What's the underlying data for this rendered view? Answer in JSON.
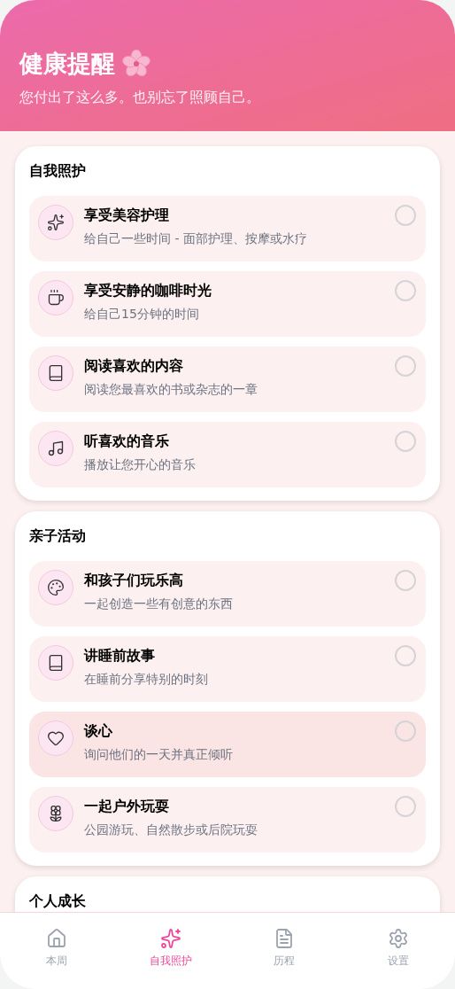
{
  "header": {
    "title": "健康提醒",
    "subtitle": "您付出了这么多。也别忘了照顾自己。"
  },
  "sections": [
    {
      "title": "自我照护",
      "items": [
        {
          "title": "享受美容护理",
          "subtitle": "给自己一些时间 - 面部护理、按摩或水疗",
          "checked": false,
          "highlighted": false
        },
        {
          "title": "享受安静的咖啡时光",
          "subtitle": "给自己15分钟的时间",
          "checked": false,
          "highlighted": false
        },
        {
          "title": "阅读喜欢的内容",
          "subtitle": "阅读您最喜欢的书或杂志的一章",
          "checked": false,
          "highlighted": false
        },
        {
          "title": "听喜欢的音乐",
          "subtitle": "播放让您开心的音乐",
          "checked": false,
          "highlighted": false
        }
      ]
    },
    {
      "title": "亲子活动",
      "items": [
        {
          "title": "和孩子们玩乐高",
          "subtitle": "一起创造一些有创意的东西",
          "checked": false,
          "highlighted": false
        },
        {
          "title": "讲睡前故事",
          "subtitle": "在睡前分享特别的时刻",
          "checked": false,
          "highlighted": false
        },
        {
          "title": "谈心",
          "subtitle": "询问他们的一天并真正倾听",
          "checked": false,
          "highlighted": true
        },
        {
          "title": "一起户外玩耍",
          "subtitle": "公园游玩、自然散步或后院玩耍",
          "checked": false,
          "highlighted": false
        }
      ]
    },
    {
      "title": "个人成长"
    }
  ],
  "nav": [
    {
      "label": "本周",
      "selected": false
    },
    {
      "label": "自我照护",
      "selected": true
    },
    {
      "label": "历程",
      "selected": false
    },
    {
      "label": "设置",
      "selected": false
    }
  ]
}
